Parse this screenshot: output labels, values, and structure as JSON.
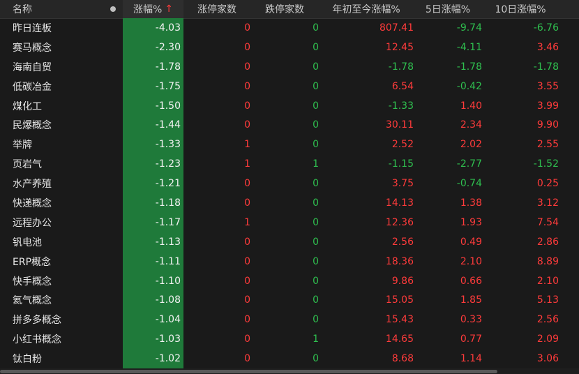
{
  "header": {
    "name": "名称",
    "pct": "涨幅%",
    "sort_arrow": "↑",
    "limit_up": "涨停家数",
    "limit_down": "跌停家数",
    "ytd": "年初至今涨幅%",
    "d5": "5日涨幅%",
    "d10": "10日涨幅%"
  },
  "rows": [
    {
      "name": "昨日连板",
      "pct": "-4.03",
      "up": "0",
      "down": "0",
      "ytd": "807.41",
      "d5": "-9.74",
      "d10": "-6.76"
    },
    {
      "name": "赛马概念",
      "pct": "-2.30",
      "up": "0",
      "down": "0",
      "ytd": "12.45",
      "d5": "-4.11",
      "d10": "3.46"
    },
    {
      "name": "海南自贸",
      "pct": "-1.78",
      "up": "0",
      "down": "0",
      "ytd": "-1.78",
      "d5": "-1.78",
      "d10": "-1.78"
    },
    {
      "name": "低碳冶金",
      "pct": "-1.75",
      "up": "0",
      "down": "0",
      "ytd": "6.54",
      "d5": "-0.42",
      "d10": "3.55"
    },
    {
      "name": "煤化工",
      "pct": "-1.50",
      "up": "0",
      "down": "0",
      "ytd": "-1.33",
      "d5": "1.40",
      "d10": "3.99"
    },
    {
      "name": "民爆概念",
      "pct": "-1.44",
      "up": "0",
      "down": "0",
      "ytd": "30.11",
      "d5": "2.34",
      "d10": "9.90"
    },
    {
      "name": "举牌",
      "pct": "-1.33",
      "up": "1",
      "down": "0",
      "ytd": "2.52",
      "d5": "2.02",
      "d10": "2.55"
    },
    {
      "name": "页岩气",
      "pct": "-1.23",
      "up": "1",
      "down": "1",
      "ytd": "-1.15",
      "d5": "-2.77",
      "d10": "-1.52"
    },
    {
      "name": "水产养殖",
      "pct": "-1.21",
      "up": "0",
      "down": "0",
      "ytd": "3.75",
      "d5": "-0.74",
      "d10": "0.25"
    },
    {
      "name": "快递概念",
      "pct": "-1.18",
      "up": "0",
      "down": "0",
      "ytd": "14.13",
      "d5": "1.38",
      "d10": "3.12"
    },
    {
      "name": "远程办公",
      "pct": "-1.17",
      "up": "1",
      "down": "0",
      "ytd": "12.36",
      "d5": "1.93",
      "d10": "7.54"
    },
    {
      "name": "钒电池",
      "pct": "-1.13",
      "up": "0",
      "down": "0",
      "ytd": "2.56",
      "d5": "0.49",
      "d10": "2.86"
    },
    {
      "name": "ERP概念",
      "pct": "-1.11",
      "up": "0",
      "down": "0",
      "ytd": "18.36",
      "d5": "2.10",
      "d10": "8.89"
    },
    {
      "name": "快手概念",
      "pct": "-1.10",
      "up": "0",
      "down": "0",
      "ytd": "9.86",
      "d5": "0.66",
      "d10": "2.10"
    },
    {
      "name": "氦气概念",
      "pct": "-1.08",
      "up": "0",
      "down": "0",
      "ytd": "15.05",
      "d5": "1.85",
      "d10": "5.13"
    },
    {
      "name": "拼多多概念",
      "pct": "-1.04",
      "up": "0",
      "down": "0",
      "ytd": "15.43",
      "d5": "0.33",
      "d10": "2.56"
    },
    {
      "name": "小红书概念",
      "pct": "-1.03",
      "up": "0",
      "down": "1",
      "ytd": "14.65",
      "d5": "0.77",
      "d10": "2.09"
    },
    {
      "name": "钛白粉",
      "pct": "-1.02",
      "up": "0",
      "down": "0",
      "ytd": "8.68",
      "d5": "1.14",
      "d10": "3.06"
    }
  ],
  "colors": {
    "positive": "#ff3b3b",
    "negative": "#2fbf4f",
    "pct_column_bg": "#1f7a3a"
  }
}
